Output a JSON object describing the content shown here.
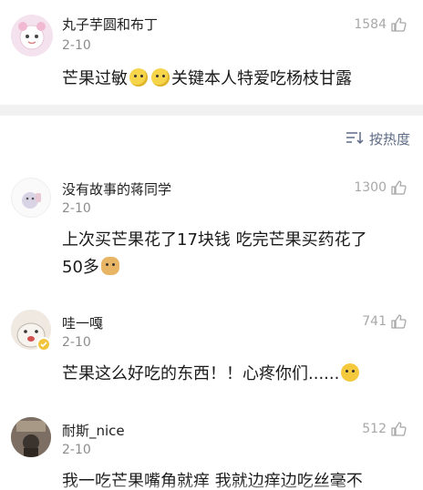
{
  "top_comment": {
    "username": "丸子芋圆和布丁",
    "date": "2-10",
    "likes": "1584",
    "text_before": "芒果过敏",
    "text_after": "关键本人特爱吃杨枝甘露"
  },
  "sort": {
    "label": "按热度"
  },
  "comments": [
    {
      "username": "没有故事的蒋同学",
      "date": "2-10",
      "likes": "1300",
      "line1": "上次买芒果花了17块钱 吃完芒果买药花了",
      "line2": "50多"
    },
    {
      "username": "哇一嘎",
      "date": "2-10",
      "likes": "741",
      "text": "芒果这么好吃的东西！！心疼你们......"
    },
    {
      "username": "耐斯_nice",
      "date": "2-10",
      "likes": "512",
      "text": "我一吃芒果嘴角就痒 我就边痒边吃丝毫不"
    }
  ],
  "icons": {
    "like": "thumbs-up-icon",
    "sort": "sort-icon",
    "verified": "verified-badge-icon"
  },
  "colors": {
    "link": "#5e6b85",
    "muted": "#a8a8a8",
    "separator": "#f1f1f1"
  }
}
